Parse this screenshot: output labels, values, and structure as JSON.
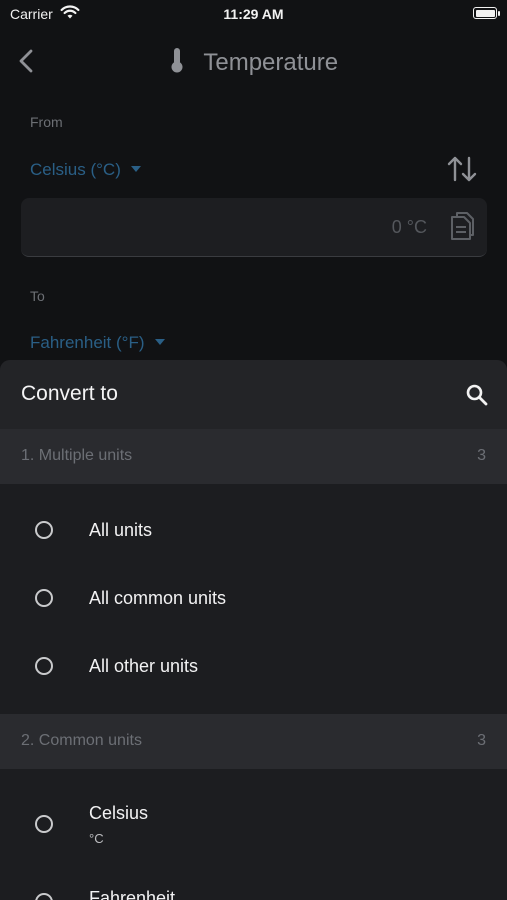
{
  "status_bar": {
    "carrier": "Carrier",
    "time": "11:29 AM"
  },
  "nav": {
    "title": "Temperature",
    "icons": [
      "back-chevron-icon",
      "thermometer-icon"
    ]
  },
  "converter": {
    "from_label": "From",
    "from_unit": "Celsius (°C)",
    "input_value": "0 °C",
    "to_label": "To",
    "to_unit": "Fahrenheit (°F)",
    "icons": [
      "swap-arrows-icon",
      "copy-icon",
      "dropdown-caret-icon"
    ]
  },
  "sheet": {
    "title": "Convert to",
    "search_icon": "search-icon",
    "sections": [
      {
        "title": "1. Multiple units",
        "count": "3",
        "items": [
          {
            "label": "All units"
          },
          {
            "label": "All common units"
          },
          {
            "label": "All other units"
          }
        ]
      },
      {
        "title": "2. Common units",
        "count": "3",
        "items": [
          {
            "label": "Celsius",
            "symbol": "°C"
          },
          {
            "label": "Fahrenheit"
          }
        ]
      }
    ]
  },
  "colors": {
    "background": "#111214",
    "sheet": "#1c1d20",
    "section_header": "#2a2b2f",
    "accent_blue": "#2a5f86",
    "muted_text": "#6c6f74"
  }
}
